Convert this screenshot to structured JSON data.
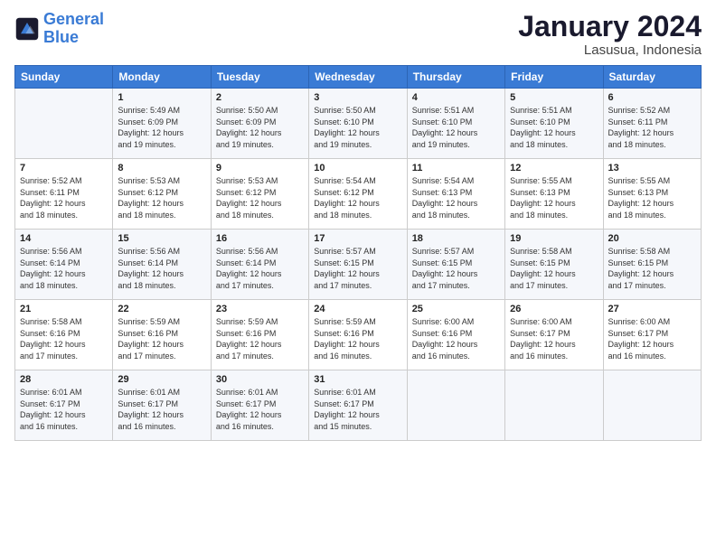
{
  "header": {
    "logo_general": "General",
    "logo_blue": "Blue",
    "month_title": "January 2024",
    "location": "Lasusua, Indonesia"
  },
  "days_of_week": [
    "Sunday",
    "Monday",
    "Tuesday",
    "Wednesday",
    "Thursday",
    "Friday",
    "Saturday"
  ],
  "weeks": [
    [
      {
        "day": "",
        "info": ""
      },
      {
        "day": "1",
        "info": "Sunrise: 5:49 AM\nSunset: 6:09 PM\nDaylight: 12 hours\nand 19 minutes."
      },
      {
        "day": "2",
        "info": "Sunrise: 5:50 AM\nSunset: 6:09 PM\nDaylight: 12 hours\nand 19 minutes."
      },
      {
        "day": "3",
        "info": "Sunrise: 5:50 AM\nSunset: 6:10 PM\nDaylight: 12 hours\nand 19 minutes."
      },
      {
        "day": "4",
        "info": "Sunrise: 5:51 AM\nSunset: 6:10 PM\nDaylight: 12 hours\nand 19 minutes."
      },
      {
        "day": "5",
        "info": "Sunrise: 5:51 AM\nSunset: 6:10 PM\nDaylight: 12 hours\nand 18 minutes."
      },
      {
        "day": "6",
        "info": "Sunrise: 5:52 AM\nSunset: 6:11 PM\nDaylight: 12 hours\nand 18 minutes."
      }
    ],
    [
      {
        "day": "7",
        "info": "Sunrise: 5:52 AM\nSunset: 6:11 PM\nDaylight: 12 hours\nand 18 minutes."
      },
      {
        "day": "8",
        "info": "Sunrise: 5:53 AM\nSunset: 6:12 PM\nDaylight: 12 hours\nand 18 minutes."
      },
      {
        "day": "9",
        "info": "Sunrise: 5:53 AM\nSunset: 6:12 PM\nDaylight: 12 hours\nand 18 minutes."
      },
      {
        "day": "10",
        "info": "Sunrise: 5:54 AM\nSunset: 6:12 PM\nDaylight: 12 hours\nand 18 minutes."
      },
      {
        "day": "11",
        "info": "Sunrise: 5:54 AM\nSunset: 6:13 PM\nDaylight: 12 hours\nand 18 minutes."
      },
      {
        "day": "12",
        "info": "Sunrise: 5:55 AM\nSunset: 6:13 PM\nDaylight: 12 hours\nand 18 minutes."
      },
      {
        "day": "13",
        "info": "Sunrise: 5:55 AM\nSunset: 6:13 PM\nDaylight: 12 hours\nand 18 minutes."
      }
    ],
    [
      {
        "day": "14",
        "info": "Sunrise: 5:56 AM\nSunset: 6:14 PM\nDaylight: 12 hours\nand 18 minutes."
      },
      {
        "day": "15",
        "info": "Sunrise: 5:56 AM\nSunset: 6:14 PM\nDaylight: 12 hours\nand 18 minutes."
      },
      {
        "day": "16",
        "info": "Sunrise: 5:56 AM\nSunset: 6:14 PM\nDaylight: 12 hours\nand 17 minutes."
      },
      {
        "day": "17",
        "info": "Sunrise: 5:57 AM\nSunset: 6:15 PM\nDaylight: 12 hours\nand 17 minutes."
      },
      {
        "day": "18",
        "info": "Sunrise: 5:57 AM\nSunset: 6:15 PM\nDaylight: 12 hours\nand 17 minutes."
      },
      {
        "day": "19",
        "info": "Sunrise: 5:58 AM\nSunset: 6:15 PM\nDaylight: 12 hours\nand 17 minutes."
      },
      {
        "day": "20",
        "info": "Sunrise: 5:58 AM\nSunset: 6:15 PM\nDaylight: 12 hours\nand 17 minutes."
      }
    ],
    [
      {
        "day": "21",
        "info": "Sunrise: 5:58 AM\nSunset: 6:16 PM\nDaylight: 12 hours\nand 17 minutes."
      },
      {
        "day": "22",
        "info": "Sunrise: 5:59 AM\nSunset: 6:16 PM\nDaylight: 12 hours\nand 17 minutes."
      },
      {
        "day": "23",
        "info": "Sunrise: 5:59 AM\nSunset: 6:16 PM\nDaylight: 12 hours\nand 17 minutes."
      },
      {
        "day": "24",
        "info": "Sunrise: 5:59 AM\nSunset: 6:16 PM\nDaylight: 12 hours\nand 16 minutes."
      },
      {
        "day": "25",
        "info": "Sunrise: 6:00 AM\nSunset: 6:16 PM\nDaylight: 12 hours\nand 16 minutes."
      },
      {
        "day": "26",
        "info": "Sunrise: 6:00 AM\nSunset: 6:17 PM\nDaylight: 12 hours\nand 16 minutes."
      },
      {
        "day": "27",
        "info": "Sunrise: 6:00 AM\nSunset: 6:17 PM\nDaylight: 12 hours\nand 16 minutes."
      }
    ],
    [
      {
        "day": "28",
        "info": "Sunrise: 6:01 AM\nSunset: 6:17 PM\nDaylight: 12 hours\nand 16 minutes."
      },
      {
        "day": "29",
        "info": "Sunrise: 6:01 AM\nSunset: 6:17 PM\nDaylight: 12 hours\nand 16 minutes."
      },
      {
        "day": "30",
        "info": "Sunrise: 6:01 AM\nSunset: 6:17 PM\nDaylight: 12 hours\nand 16 minutes."
      },
      {
        "day": "31",
        "info": "Sunrise: 6:01 AM\nSunset: 6:17 PM\nDaylight: 12 hours\nand 15 minutes."
      },
      {
        "day": "",
        "info": ""
      },
      {
        "day": "",
        "info": ""
      },
      {
        "day": "",
        "info": ""
      }
    ]
  ]
}
